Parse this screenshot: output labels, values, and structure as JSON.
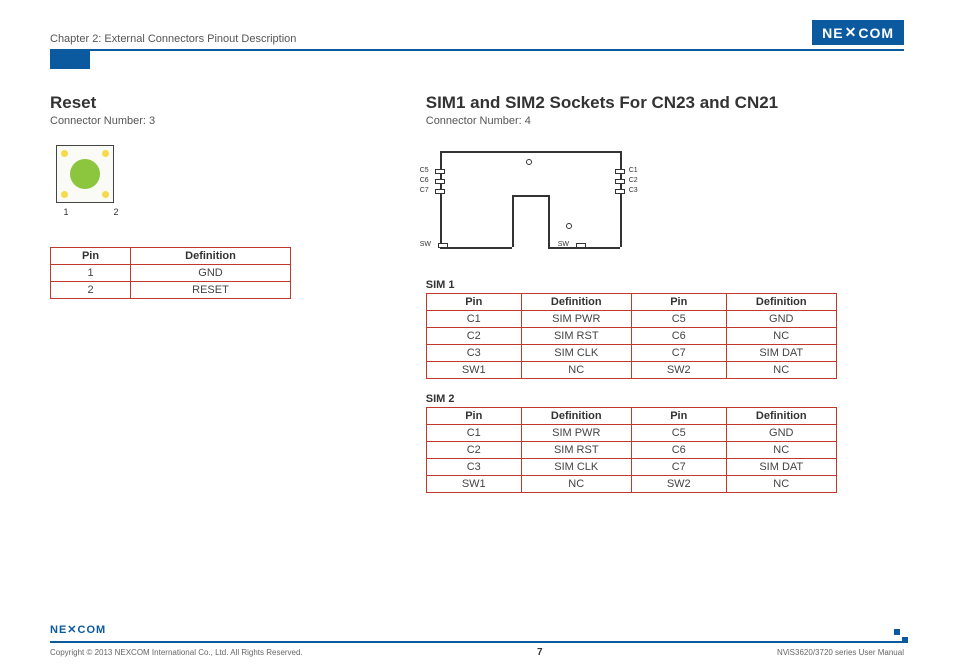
{
  "header": {
    "chapter": "Chapter 2: External Connectors Pinout Description",
    "brand": "NEXCOM"
  },
  "left": {
    "title": "Reset",
    "subtitle": "Connector Number: 3",
    "pin_labels": {
      "l": "1",
      "r": "2"
    },
    "table": {
      "headers": [
        "Pin",
        "Definition"
      ],
      "rows": [
        [
          "1",
          "GND"
        ],
        [
          "2",
          "RESET"
        ]
      ]
    }
  },
  "right": {
    "title": "SIM1 and SIM2 Sockets For CN23 and CN21",
    "subtitle": "Connector Number: 4",
    "diagram_labels": {
      "left_pins": [
        "C5",
        "C6",
        "C7"
      ],
      "right_pins": [
        "C1",
        "C2",
        "C3"
      ],
      "sw_left": "SW",
      "sw_right": "SW"
    },
    "sim1": {
      "title": "SIM 1",
      "headers": [
        "Pin",
        "Definition",
        "Pin",
        "Definition"
      ],
      "rows": [
        [
          "C1",
          "SIM PWR",
          "C5",
          "GND"
        ],
        [
          "C2",
          "SIM RST",
          "C6",
          "NC"
        ],
        [
          "C3",
          "SIM CLK",
          "C7",
          "SIM DAT"
        ],
        [
          "SW1",
          "NC",
          "SW2",
          "NC"
        ]
      ]
    },
    "sim2": {
      "title": "SIM 2",
      "headers": [
        "Pin",
        "Definition",
        "Pin",
        "Definition"
      ],
      "rows": [
        [
          "C1",
          "SIM PWR",
          "C5",
          "GND"
        ],
        [
          "C2",
          "SIM RST",
          "C6",
          "NC"
        ],
        [
          "C3",
          "SIM CLK",
          "C7",
          "SIM DAT"
        ],
        [
          "SW1",
          "NC",
          "SW2",
          "NC"
        ]
      ]
    }
  },
  "footer": {
    "brand": "NEXCOM",
    "copyright": "Copyright © 2013 NEXCOM International Co., Ltd. All Rights Reserved.",
    "page": "7",
    "doc": "NViS3620/3720 series User Manual"
  }
}
